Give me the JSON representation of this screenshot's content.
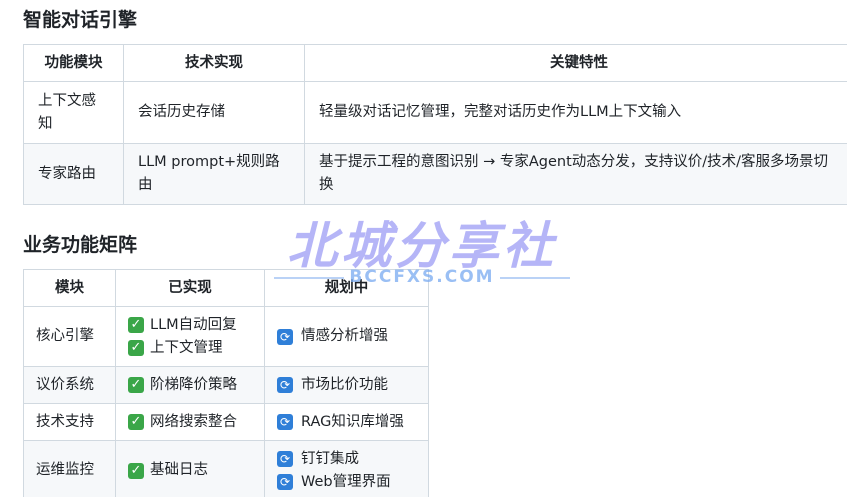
{
  "section1": {
    "title": "智能对话引擎",
    "headers": [
      "功能模块",
      "技术实现",
      "关键特性"
    ],
    "rows": [
      [
        "上下文感知",
        "会话历史存储",
        "轻量级对话记忆管理，完整对话历史作为LLM上下文输入"
      ],
      [
        "专家路由",
        "LLM prompt+规则路由",
        "基于提示工程的意图识别 → 专家Agent动态分发，支持议价/技术/客服多场景切换"
      ]
    ]
  },
  "section2": {
    "title": "业务功能矩阵",
    "headers": [
      "模块",
      "已实现",
      "规划中"
    ],
    "rows": [
      {
        "module": "核心引擎",
        "done": [
          "LLM自动回复",
          "上下文管理"
        ],
        "planned": [
          "情感分析增强"
        ]
      },
      {
        "module": "议价系统",
        "done": [
          "阶梯降价策略"
        ],
        "planned": [
          "市场比价功能"
        ]
      },
      {
        "module": "技术支持",
        "done": [
          "网络搜索整合"
        ],
        "planned": [
          "RAG知识库增强"
        ]
      },
      {
        "module": "运维监控",
        "done": [
          "基础日志"
        ],
        "planned": [
          "钉钉集成",
          "Web管理界面"
        ]
      }
    ]
  },
  "watermark": {
    "main": "北城分享社",
    "sub": "BCCFXS.COM"
  },
  "colors": {
    "check": "#3aa648",
    "sync": "#2f7fd8",
    "border": "#d1d9e0"
  },
  "icons": {
    "done": "check-mark-icon",
    "planned": "sync-arrows-icon"
  }
}
